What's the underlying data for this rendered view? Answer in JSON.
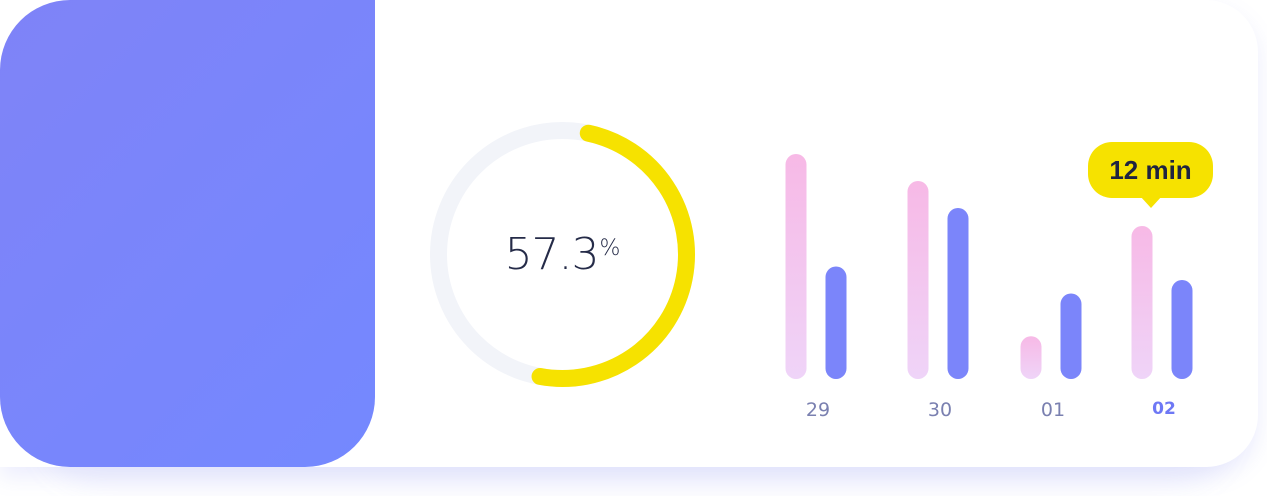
{
  "progress": {
    "value_text": "57.3",
    "unit": "%",
    "fraction": 0.573,
    "track_color": "#f2f4f9",
    "fill_color": "#f6e200"
  },
  "tooltip": {
    "text": "12 min"
  },
  "colors": {
    "panel_start": "#7f83f7",
    "panel_end": "#7488ff",
    "pink_bar": "#f7b9e6",
    "blue_bar": "#7b85fa",
    "tooltip": "#f6e200"
  },
  "chart_data": {
    "type": "bar",
    "categories": [
      "29",
      "30",
      "01",
      "02"
    ],
    "active_category": "02",
    "series": [
      {
        "values": [
          10,
          8.8,
          1.9,
          6.8
        ],
        "color": "#f7b9e6"
      },
      {
        "values": [
          5,
          7.6,
          3.8,
          4.4
        ],
        "color": "#7b85fa"
      }
    ],
    "ylim": [
      0,
      10
    ]
  }
}
